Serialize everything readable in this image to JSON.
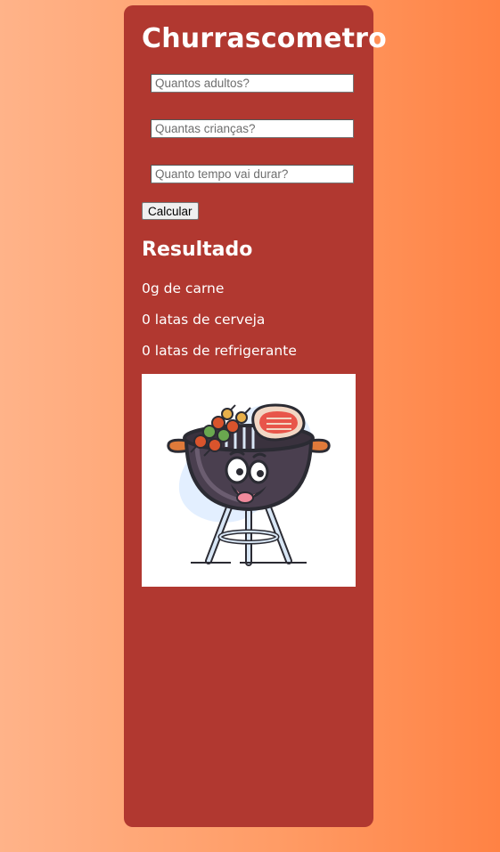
{
  "app": {
    "title": "Churrascometro"
  },
  "form": {
    "adults_placeholder": "Quantos adultos?",
    "children_placeholder": "Quantas crianças?",
    "duration_placeholder": "Quanto tempo vai durar?",
    "calculate_label": "Calcular"
  },
  "result": {
    "title": "Resultado",
    "meat": "0g de carne",
    "beer": "0 latas de cerveja",
    "soda": "0 latas de refrigerante"
  },
  "colors": {
    "card_background": "#b13830",
    "page_gradient_start": "#ffb389",
    "page_gradient_end": "#ff8244"
  },
  "image": {
    "icon": "barbecue-grill-mascot-icon"
  }
}
